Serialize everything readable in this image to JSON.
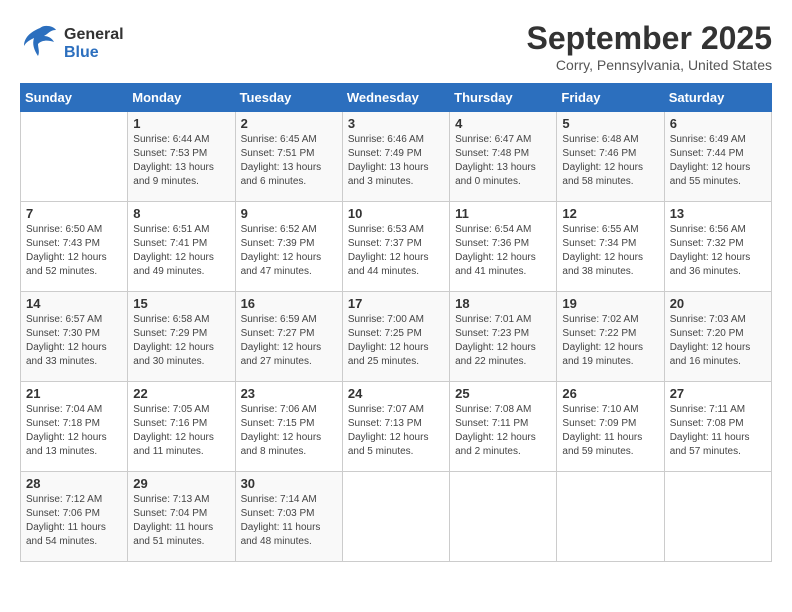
{
  "header": {
    "logo_line1": "General",
    "logo_line2": "Blue",
    "month_title": "September 2025",
    "subtitle": "Corry, Pennsylvania, United States"
  },
  "weekdays": [
    "Sunday",
    "Monday",
    "Tuesday",
    "Wednesday",
    "Thursday",
    "Friday",
    "Saturday"
  ],
  "weeks": [
    [
      {
        "day": "",
        "info": ""
      },
      {
        "day": "1",
        "info": "Sunrise: 6:44 AM\nSunset: 7:53 PM\nDaylight: 13 hours\nand 9 minutes."
      },
      {
        "day": "2",
        "info": "Sunrise: 6:45 AM\nSunset: 7:51 PM\nDaylight: 13 hours\nand 6 minutes."
      },
      {
        "day": "3",
        "info": "Sunrise: 6:46 AM\nSunset: 7:49 PM\nDaylight: 13 hours\nand 3 minutes."
      },
      {
        "day": "4",
        "info": "Sunrise: 6:47 AM\nSunset: 7:48 PM\nDaylight: 13 hours\nand 0 minutes."
      },
      {
        "day": "5",
        "info": "Sunrise: 6:48 AM\nSunset: 7:46 PM\nDaylight: 12 hours\nand 58 minutes."
      },
      {
        "day": "6",
        "info": "Sunrise: 6:49 AM\nSunset: 7:44 PM\nDaylight: 12 hours\nand 55 minutes."
      }
    ],
    [
      {
        "day": "7",
        "info": "Sunrise: 6:50 AM\nSunset: 7:43 PM\nDaylight: 12 hours\nand 52 minutes."
      },
      {
        "day": "8",
        "info": "Sunrise: 6:51 AM\nSunset: 7:41 PM\nDaylight: 12 hours\nand 49 minutes."
      },
      {
        "day": "9",
        "info": "Sunrise: 6:52 AM\nSunset: 7:39 PM\nDaylight: 12 hours\nand 47 minutes."
      },
      {
        "day": "10",
        "info": "Sunrise: 6:53 AM\nSunset: 7:37 PM\nDaylight: 12 hours\nand 44 minutes."
      },
      {
        "day": "11",
        "info": "Sunrise: 6:54 AM\nSunset: 7:36 PM\nDaylight: 12 hours\nand 41 minutes."
      },
      {
        "day": "12",
        "info": "Sunrise: 6:55 AM\nSunset: 7:34 PM\nDaylight: 12 hours\nand 38 minutes."
      },
      {
        "day": "13",
        "info": "Sunrise: 6:56 AM\nSunset: 7:32 PM\nDaylight: 12 hours\nand 36 minutes."
      }
    ],
    [
      {
        "day": "14",
        "info": "Sunrise: 6:57 AM\nSunset: 7:30 PM\nDaylight: 12 hours\nand 33 minutes."
      },
      {
        "day": "15",
        "info": "Sunrise: 6:58 AM\nSunset: 7:29 PM\nDaylight: 12 hours\nand 30 minutes."
      },
      {
        "day": "16",
        "info": "Sunrise: 6:59 AM\nSunset: 7:27 PM\nDaylight: 12 hours\nand 27 minutes."
      },
      {
        "day": "17",
        "info": "Sunrise: 7:00 AM\nSunset: 7:25 PM\nDaylight: 12 hours\nand 25 minutes."
      },
      {
        "day": "18",
        "info": "Sunrise: 7:01 AM\nSunset: 7:23 PM\nDaylight: 12 hours\nand 22 minutes."
      },
      {
        "day": "19",
        "info": "Sunrise: 7:02 AM\nSunset: 7:22 PM\nDaylight: 12 hours\nand 19 minutes."
      },
      {
        "day": "20",
        "info": "Sunrise: 7:03 AM\nSunset: 7:20 PM\nDaylight: 12 hours\nand 16 minutes."
      }
    ],
    [
      {
        "day": "21",
        "info": "Sunrise: 7:04 AM\nSunset: 7:18 PM\nDaylight: 12 hours\nand 13 minutes."
      },
      {
        "day": "22",
        "info": "Sunrise: 7:05 AM\nSunset: 7:16 PM\nDaylight: 12 hours\nand 11 minutes."
      },
      {
        "day": "23",
        "info": "Sunrise: 7:06 AM\nSunset: 7:15 PM\nDaylight: 12 hours\nand 8 minutes."
      },
      {
        "day": "24",
        "info": "Sunrise: 7:07 AM\nSunset: 7:13 PM\nDaylight: 12 hours\nand 5 minutes."
      },
      {
        "day": "25",
        "info": "Sunrise: 7:08 AM\nSunset: 7:11 PM\nDaylight: 12 hours\nand 2 minutes."
      },
      {
        "day": "26",
        "info": "Sunrise: 7:10 AM\nSunset: 7:09 PM\nDaylight: 11 hours\nand 59 minutes."
      },
      {
        "day": "27",
        "info": "Sunrise: 7:11 AM\nSunset: 7:08 PM\nDaylight: 11 hours\nand 57 minutes."
      }
    ],
    [
      {
        "day": "28",
        "info": "Sunrise: 7:12 AM\nSunset: 7:06 PM\nDaylight: 11 hours\nand 54 minutes."
      },
      {
        "day": "29",
        "info": "Sunrise: 7:13 AM\nSunset: 7:04 PM\nDaylight: 11 hours\nand 51 minutes."
      },
      {
        "day": "30",
        "info": "Sunrise: 7:14 AM\nSunset: 7:03 PM\nDaylight: 11 hours\nand 48 minutes."
      },
      {
        "day": "",
        "info": ""
      },
      {
        "day": "",
        "info": ""
      },
      {
        "day": "",
        "info": ""
      },
      {
        "day": "",
        "info": ""
      }
    ]
  ]
}
